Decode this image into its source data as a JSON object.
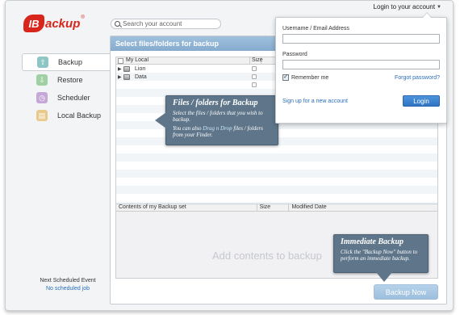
{
  "header": {
    "logo_badge": "IB",
    "logo_text": "ackup",
    "logo_reg": "®",
    "search_placeholder": "Search your account",
    "login_link": "Login to your account"
  },
  "sidebar": {
    "items": [
      {
        "label": "Backup",
        "icon": "backup-icon"
      },
      {
        "label": "Restore",
        "icon": "restore-icon"
      },
      {
        "label": "Scheduler",
        "icon": "scheduler-icon"
      },
      {
        "label": "Local Backup",
        "icon": "local-backup-icon"
      }
    ],
    "next_event_label": "Next Scheduled Event",
    "next_event_value": "No scheduled job"
  },
  "main": {
    "title": "Select files/folders for backup",
    "tree": {
      "columns": [
        "My Local",
        "Size"
      ],
      "rows": [
        {
          "name": "Lion"
        },
        {
          "name": "Data"
        }
      ]
    },
    "backup_set": {
      "columns": [
        "Contents of my Backup set",
        "Size",
        "Modified Date"
      ],
      "placeholder": "Add contents to backup"
    },
    "backup_now_label": "Backup Now"
  },
  "tips": {
    "files": {
      "title": "Files / folders for Backup",
      "line1": "Select the files / folders that you wish to backup.",
      "line2_pre": "You can also ",
      "line2_hl": "Drag n Drop",
      "line2_post": " files / folders from your Finder."
    },
    "immediate": {
      "title": "Immediate Backup",
      "body": "Click the \"Backup Now\" button to perform an immediate backup."
    }
  },
  "login": {
    "username_label": "Username / Email Address",
    "username_value": "",
    "password_label": "Password",
    "password_value": "",
    "remember_label": "Remember me",
    "remember_checked": true,
    "forgot_label": "Forgot password?",
    "signup_label": "Sign up for a new account",
    "login_button": "Login"
  }
}
